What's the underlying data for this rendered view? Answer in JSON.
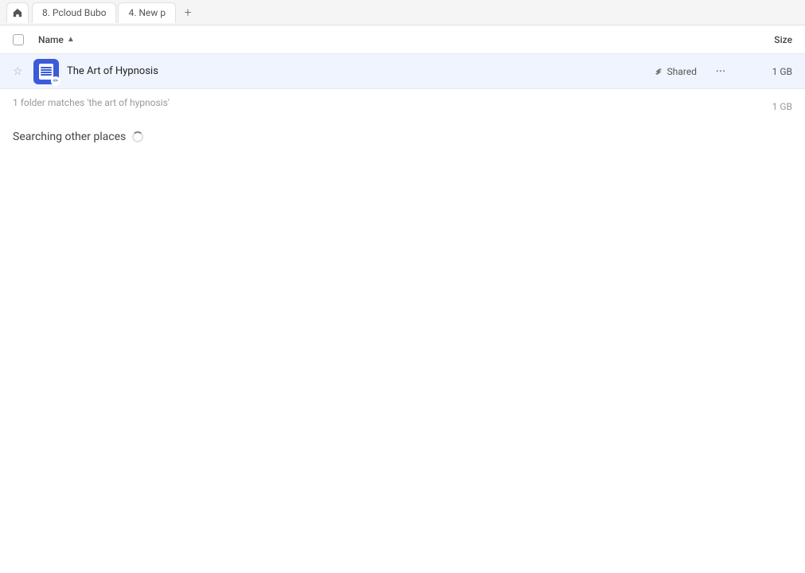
{
  "tabs": [
    {
      "id": "home",
      "icon": "🏠",
      "label": null
    },
    {
      "id": "tab1",
      "label": "8. Pcloud Bubo"
    },
    {
      "id": "tab2",
      "label": "4. New p"
    },
    {
      "id": "new",
      "label": "+"
    }
  ],
  "columns": {
    "name_label": "Name",
    "size_label": "Size"
  },
  "file_row": {
    "name": "The Art of Hypnosis",
    "shared_label": "Shared",
    "size": "1 GB"
  },
  "match_text": "1 folder matches 'the art of hypnosis'",
  "match_size": "1 GB",
  "searching_label": "Searching other places"
}
